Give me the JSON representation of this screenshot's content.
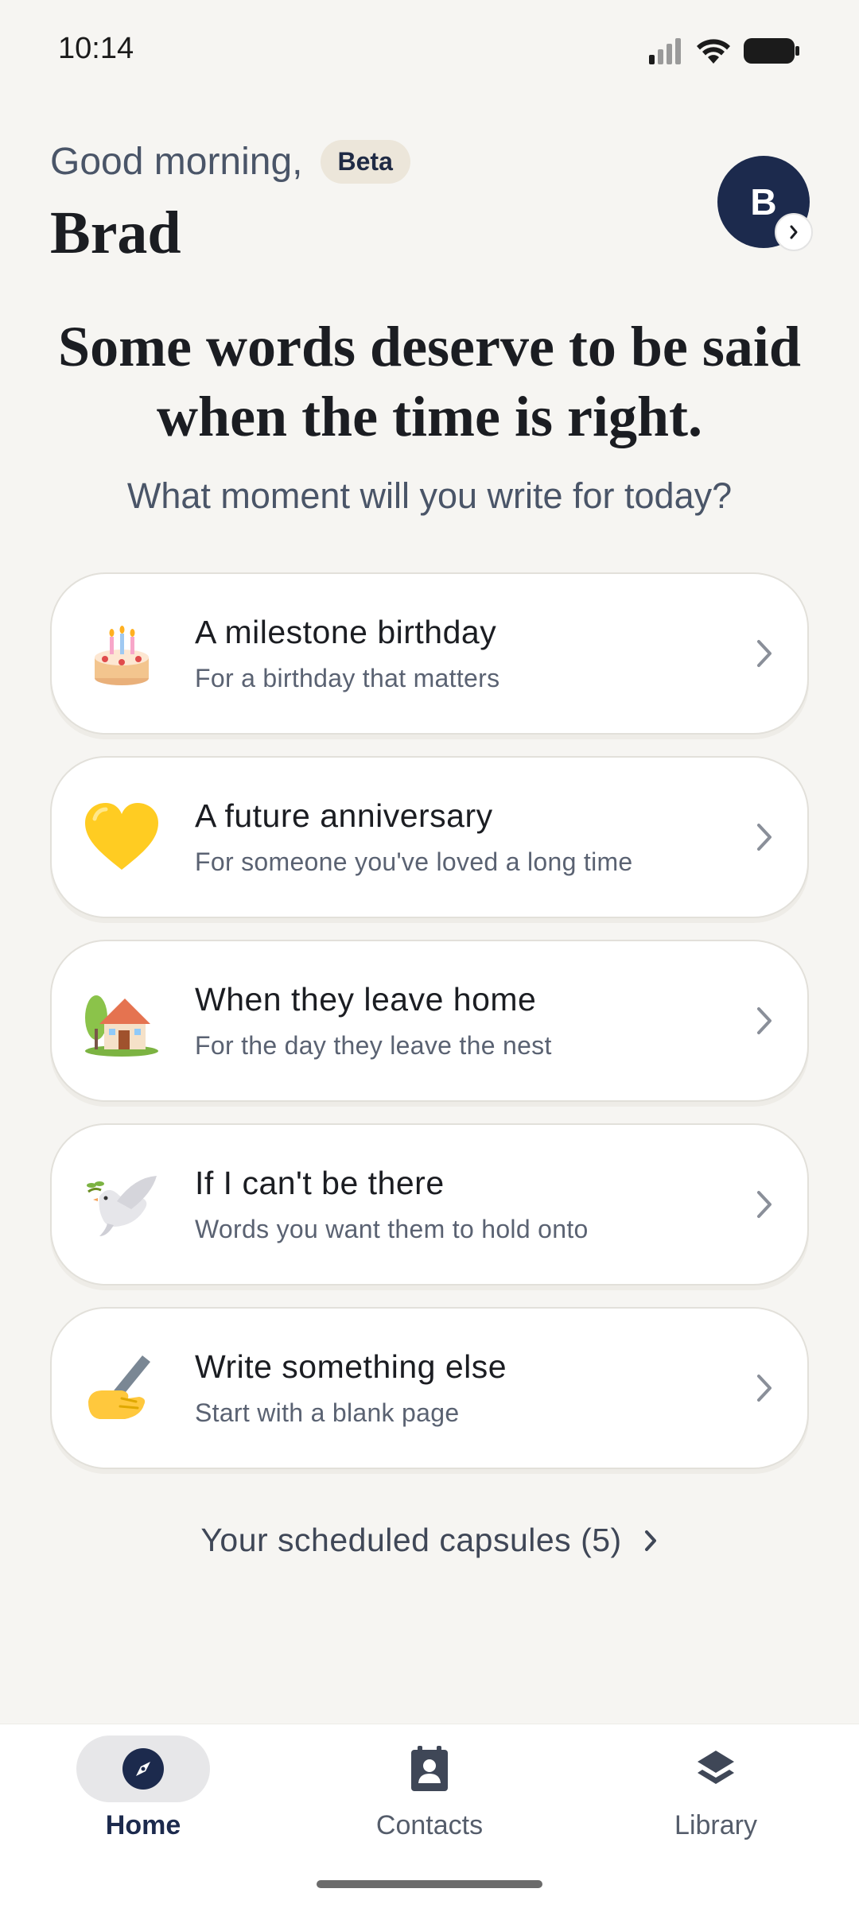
{
  "status_bar": {
    "time": "10:14"
  },
  "header": {
    "greeting": "Good morning,",
    "badge": "Beta",
    "user_name": "Brad",
    "avatar_initial": "B"
  },
  "hero": {
    "headline": "Some words deserve to be said when the time is right.",
    "subheadline": "What moment will you write for today?"
  },
  "cards": [
    {
      "icon": "birthday-cake-icon",
      "title": "A milestone birthday",
      "subtitle": "For a birthday that matters"
    },
    {
      "icon": "yellow-heart-icon",
      "title": "A future anniversary",
      "subtitle": "For someone you've loved a long time"
    },
    {
      "icon": "house-icon",
      "title": "When they leave home",
      "subtitle": "For the day they leave the nest"
    },
    {
      "icon": "dove-icon",
      "title": "If I can't be there",
      "subtitle": "Words you want them to hold onto"
    },
    {
      "icon": "writing-hand-icon",
      "title": "Write something else",
      "subtitle": "Start with a blank page"
    }
  ],
  "scheduled": {
    "label": "Your scheduled capsules (5)"
  },
  "bottom_nav": {
    "items": [
      {
        "label": "Home",
        "icon": "compass-icon",
        "active": true
      },
      {
        "label": "Contacts",
        "icon": "contacts-icon",
        "active": false
      },
      {
        "label": "Library",
        "icon": "layers-icon",
        "active": false
      }
    ]
  },
  "colors": {
    "background": "#f6f5f2",
    "navy": "#1c2a4d",
    "badge_bg": "#ece6da",
    "text_secondary": "#4a5568"
  }
}
